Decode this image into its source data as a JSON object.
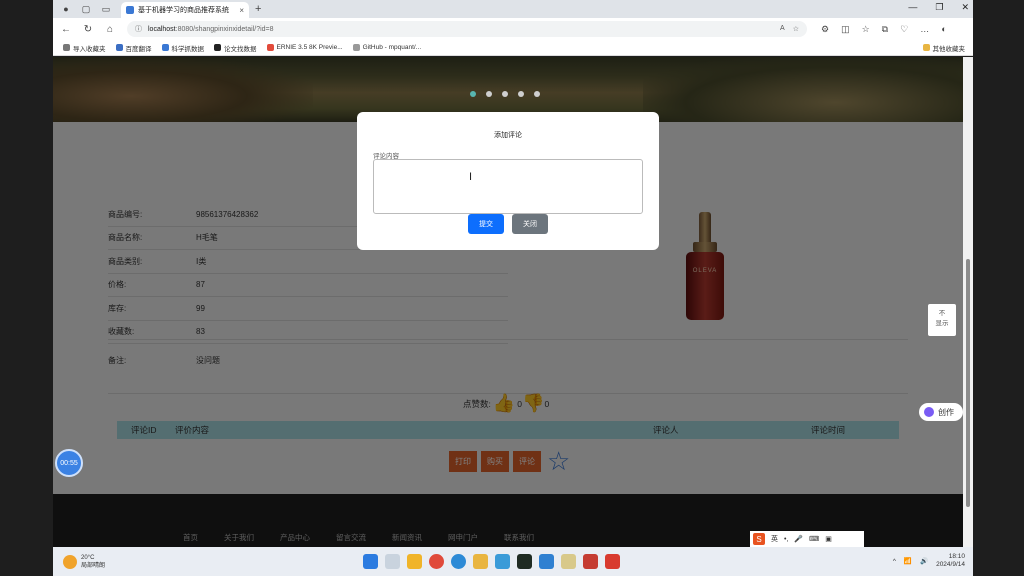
{
  "browser": {
    "tab_title": "基于机器学习的商品推荐系统",
    "url_host": "localhost",
    "url_rest": ":8080/shangpinxinxidetail/?id=8",
    "bookmarks": [
      "导入收藏夹",
      "百度翻译",
      "科学抓数据",
      "论文找数据",
      "ERNIE 3.5 8K Previe...",
      "GitHub - mpquant/..."
    ],
    "other_bookmarks": "其他收藏夹"
  },
  "product": {
    "fields": [
      {
        "key": "商品编号:",
        "value": "98561376428362"
      },
      {
        "key": "商品名称:",
        "value": "H毛笔"
      },
      {
        "key": "商品类别:",
        "value": "Ⅰ类"
      },
      {
        "key": "价格:",
        "value": "87"
      },
      {
        "key": "库存:",
        "value": "99"
      },
      {
        "key": "收藏数:",
        "value": "83"
      }
    ],
    "note_key": "备注:",
    "note_value": "没问题",
    "bottle_label": "OLEVA",
    "likes_label": "点赞数:",
    "likes_count": "0",
    "dislikes_count": "0"
  },
  "comments_table": {
    "headers": [
      "评论ID",
      "评价内容",
      "评论人",
      "评论时间"
    ]
  },
  "actions": {
    "print": "打印",
    "buy": "购买",
    "comment": "评论"
  },
  "footer": {
    "links": [
      "首页",
      "关于我们",
      "产品中心",
      "留言交流",
      "新闻资讯",
      "网申门户",
      "联系我们"
    ]
  },
  "modal": {
    "title": "添加评论",
    "field_label": "评论内容",
    "textarea_value": "",
    "submit": "提交",
    "close": "关闭"
  },
  "overlay_widgets": {
    "side_button": "不\n显示",
    "chuangzuo": "创作",
    "timer": "00:55",
    "ime_lang": "英"
  },
  "taskbar": {
    "temp": "20°C",
    "weather": "局部晴朗",
    "time": "18:10",
    "date": "2024/9/14"
  },
  "colors": {
    "accent_primary": "#0d6efd",
    "action_orange": "#e0622b",
    "table_header": "#a9dce3"
  }
}
